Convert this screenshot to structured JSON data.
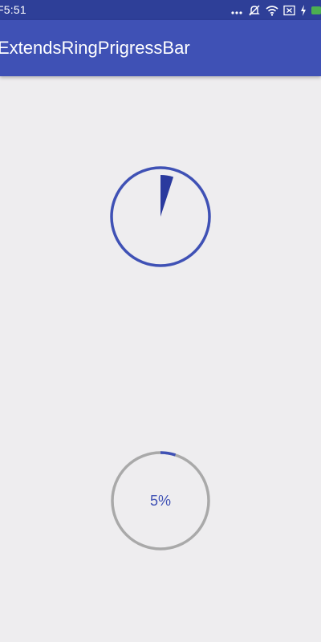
{
  "status_bar": {
    "time": "F5:51",
    "icons": [
      "more-dots-icon",
      "mute-icon",
      "wifi-icon",
      "close-box-icon",
      "charging-icon",
      "battery-icon"
    ],
    "color": "#2E3F98"
  },
  "app_bar": {
    "title": "ExtendsRingPrigressBar",
    "color": "#3F51B5"
  },
  "progress_pie": {
    "progress": 0.05,
    "ring_color": "#3F51B5",
    "fill_color": "#2A3A9E"
  },
  "progress_ring": {
    "label": "5%",
    "progress": 0.05,
    "track_color": "#A9A9A9",
    "progress_color": "#3F51B5",
    "label_color": "#3F51B5"
  }
}
